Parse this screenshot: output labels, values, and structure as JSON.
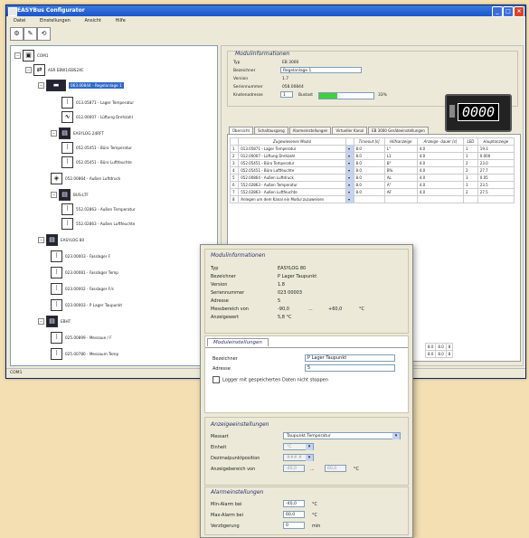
{
  "window": {
    "title": "EASYBus Configurator",
    "menu": [
      "Datei",
      "Einstellungen",
      "Ansicht",
      "Hilfe"
    ],
    "status": "COM1"
  },
  "tree": {
    "port": "COM1",
    "bus": "ASR EBW1/EBS2XC",
    "selected": "063.00844 - Regelanlage 1",
    "nodes": [
      {
        "label": "013.05871 - Lager Temperatur",
        "icon": "thermometer-icon"
      },
      {
        "label": "012.00007 - Lüftung Drehzahl",
        "icon": "fan-icon"
      },
      {
        "label": "EASYLOG 24RFT",
        "icon": "device-icon"
      },
      {
        "label": "052.05451 - Büro Temperatur",
        "icon": "thermometer-icon"
      },
      {
        "label": "052.05451 - Büro Luftfeuchte",
        "icon": "humidity-icon"
      },
      {
        "label": "052.00864 - Außen Luftdruck",
        "icon": "pressure-icon"
      },
      {
        "label": "BUS-LTF",
        "icon": "device-icon"
      },
      {
        "label": "552.02863 - Außen Temperatur",
        "icon": "thermometer-icon"
      },
      {
        "label": "552.02863 - Außen Luftfeuchte",
        "icon": "humidity-icon"
      },
      {
        "label": "EASYLOG 80",
        "icon": "device-icon"
      },
      {
        "label": "023.00003 - Fasslager F",
        "icon": "thermometer-icon"
      },
      {
        "label": "023.00081 - Fasslager Temp",
        "icon": "thermometer-icon"
      },
      {
        "label": "023.00002 - Fasslager F/s",
        "icon": "thermometer-icon"
      },
      {
        "label": "023.00003 - P Lager Taupunkt",
        "icon": "thermometer-icon"
      },
      {
        "label": "EBHT",
        "icon": "device-icon"
      },
      {
        "label": "025.00899 - Messaue / F",
        "icon": "thermometer-icon"
      },
      {
        "label": "025.00780 - Messaum Temp",
        "icon": "thermometer-icon"
      }
    ]
  },
  "modulinfo": {
    "title": "Modulinformationen",
    "typ_label": "Typ",
    "typ": "EB 3000",
    "bez_label": "Bezeichner",
    "bez": "Regelanlage 1",
    "version_label": "Version",
    "version": "1.7",
    "serial_label": "Seriennummer",
    "serial": "058.00844",
    "knoten_label": "Knotenadresse",
    "knoten": "1",
    "busload_label": "Buslast",
    "busload": "33%",
    "busload_fraction": 0.33,
    "display": "0000"
  },
  "tabs": [
    "Übersicht",
    "Schaltausgang",
    "Alarmeinstellungen",
    "Virtueller Kanal",
    "EB 3000 Geräteeinstellungen"
  ],
  "grid": {
    "headers": [
      "",
      "Zugewiesenes Modul",
      "",
      "Timeout [s]",
      "Hilfsanzeige",
      "Anzeige- dauer [s]",
      "LED",
      "Hauptanzeige"
    ],
    "rows": [
      [
        "1",
        "013.05871 - Lager Temperatur",
        "▾",
        "8.0",
        "L°",
        "4.0",
        "1",
        "19.3"
      ],
      [
        "2",
        "012.00007 - Lüftung Drehzahl",
        "▾",
        "8.0",
        "L1",
        "4.0",
        "1",
        "0.000"
      ],
      [
        "3",
        "052.05451 - Büro Temperatur",
        "▾",
        "8.0",
        "B°",
        "4.0",
        "2",
        "23.0"
      ],
      [
        "4",
        "052.05451 - Büro Luftfeuchte",
        "▾",
        "8.0",
        "B%",
        "4.0",
        "2",
        "27.7"
      ],
      [
        "5",
        "052.00864 - Außen Luftdruck",
        "▾",
        "8.0",
        "AL",
        "4.0",
        "3",
        "0.05"
      ],
      [
        "6",
        "552.02863 - Außen Temperatur",
        "▾",
        "8.0",
        "A°",
        "4.0",
        "1",
        "23.5"
      ],
      [
        "7",
        "552.02863 - Außen Luftfeuchte",
        "▾",
        "8.0",
        "AF",
        "4.0",
        "2",
        "27.5"
      ],
      [
        "8",
        "Anlegen um dem Kanal ein Modul zuzuweisen",
        "▾",
        "",
        "",
        "",
        "",
        ""
      ]
    ],
    "extra_rows": [
      [
        "",
        "",
        "",
        "8.0",
        "",
        "8.0",
        "8",
        ""
      ],
      [
        "",
        "",
        "",
        "8.0",
        "",
        "8.0",
        "8",
        ""
      ]
    ]
  },
  "dialog": {
    "info": {
      "title": "Modulinformationen",
      "typ_label": "Typ",
      "typ": "EASYLOG 80",
      "bez_label": "Bezeichner",
      "bez": "P Lager Taupunkt",
      "version_label": "Version",
      "version": "1.8",
      "serial_label": "Seriennummer",
      "serial": "023 00003",
      "adresse_label": "Adresse",
      "adresse": "5",
      "range_label": "Messbereich von",
      "range_from": "-90,0",
      "range_dash": "...",
      "range_to": "+60,0",
      "range_unit": "°C",
      "value_label": "Anzeigewert",
      "value": "5,8 °C"
    },
    "settings": {
      "tab": "Moduleinstellungen",
      "bez_label": "Bezeichner",
      "bez": "P Lager Taupunkt",
      "adresse_label": "Adresse",
      "adresse": "5",
      "logger_label": "Logger mit gespeicherten Daten nicht stoppen"
    },
    "display": {
      "title": "Anzeigeeinstellungen",
      "messart_label": "Messart",
      "messart": "Taupunkt Temperatur",
      "einheit_label": "Einheit",
      "einheit": "°C",
      "dez_label": "Dezimalpunktposition",
      "dez": "###.#",
      "range_label": "Anzeigebereich von",
      "range_from": "-40,0",
      "range_dash": "...",
      "range_to": "60,0",
      "range_unit": "°C"
    },
    "alarm": {
      "title": "Alarmeinstellungen",
      "min_label": "Min-Alarm bei",
      "min": "-40,0",
      "min_unit": "°C",
      "max_label": "Max-Alarm bei",
      "max": "60,0",
      "max_unit": "°C",
      "delay_label": "Verzögerung",
      "delay": "0",
      "delay_unit": "min"
    }
  }
}
